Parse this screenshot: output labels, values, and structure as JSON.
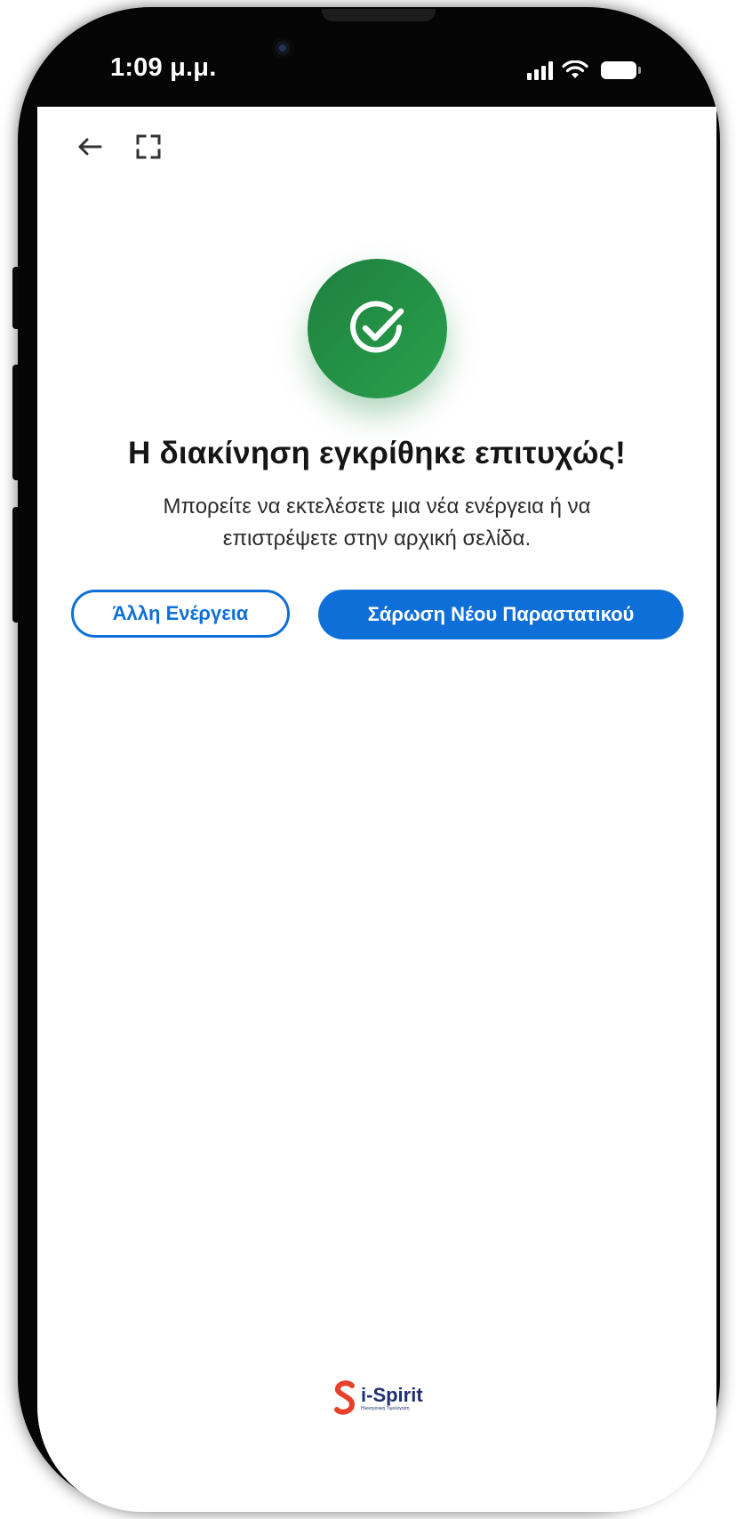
{
  "status_bar": {
    "time": "1:09 μ.μ."
  },
  "icons": {
    "back": "arrow-left-icon",
    "fullscreen": "fullscreen-icon",
    "success": "check-circle-icon",
    "signal": "cellular-signal-icon",
    "wifi": "wifi-icon",
    "battery": "battery-icon"
  },
  "content": {
    "title": "Η διακίνηση εγκρίθηκε επιτυχώς!",
    "subtitle": "Μπορείτε να εκτελέσετε μια νέα ενέργεια ή να επιστρέψετε στην αρχική σελίδα."
  },
  "actions": {
    "other_action_label": "Άλλη Ενέργεια",
    "scan_new_label": "Σάρωση Νέου Παραστατικού"
  },
  "brand": {
    "name": "i-Spirit",
    "tagline": "Ηλεκτρονική Τιμολόγηση"
  },
  "colors": {
    "primary": "#0f6fd8",
    "success": "#28a14c",
    "text": "#151515"
  }
}
